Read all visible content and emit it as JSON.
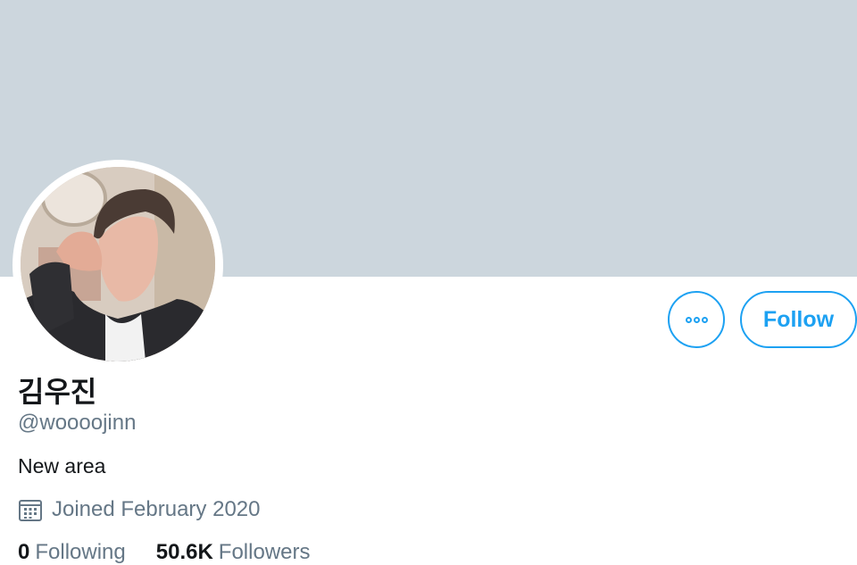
{
  "profile": {
    "display_name": "김우진",
    "handle": "@woooojinn",
    "bio": "New area",
    "joined": "Joined February 2020"
  },
  "actions": {
    "more_icon": "more-horizontal-icon",
    "follow_label": "Follow"
  },
  "stats": {
    "following_count": "0",
    "following_label": "Following",
    "followers_count": "50.6K",
    "followers_label": "Followers"
  },
  "colors": {
    "banner": "#ccd6dd",
    "accent": "#1da1f2",
    "primary_text": "#14171a",
    "secondary_text": "#657786"
  }
}
